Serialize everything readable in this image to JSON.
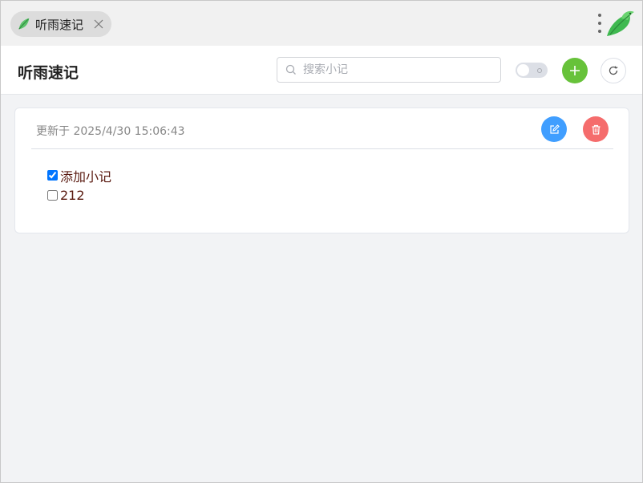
{
  "tab": {
    "label": "听雨速记"
  },
  "header": {
    "title": "听雨速记",
    "search_placeholder": "搜索小记"
  },
  "notes": [
    {
      "updated": "更新于 2025/4/30 15:06:43",
      "items": [
        {
          "text": "添加小记",
          "checked": true
        },
        {
          "text": "212",
          "checked": false
        }
      ]
    }
  ],
  "colors": {
    "add": "#67c23a",
    "edit": "#409eff",
    "delete": "#f56c6c",
    "brand_green": "#4caf50"
  },
  "icons": {
    "tab": "leaf-logo-icon",
    "close": "close-icon",
    "menu": "kebab-menu-icon",
    "brand": "bird-logo-icon",
    "search": "search-icon",
    "add": "plus-icon",
    "refresh": "refresh-icon",
    "edit": "edit-icon",
    "delete": "trash-icon"
  }
}
